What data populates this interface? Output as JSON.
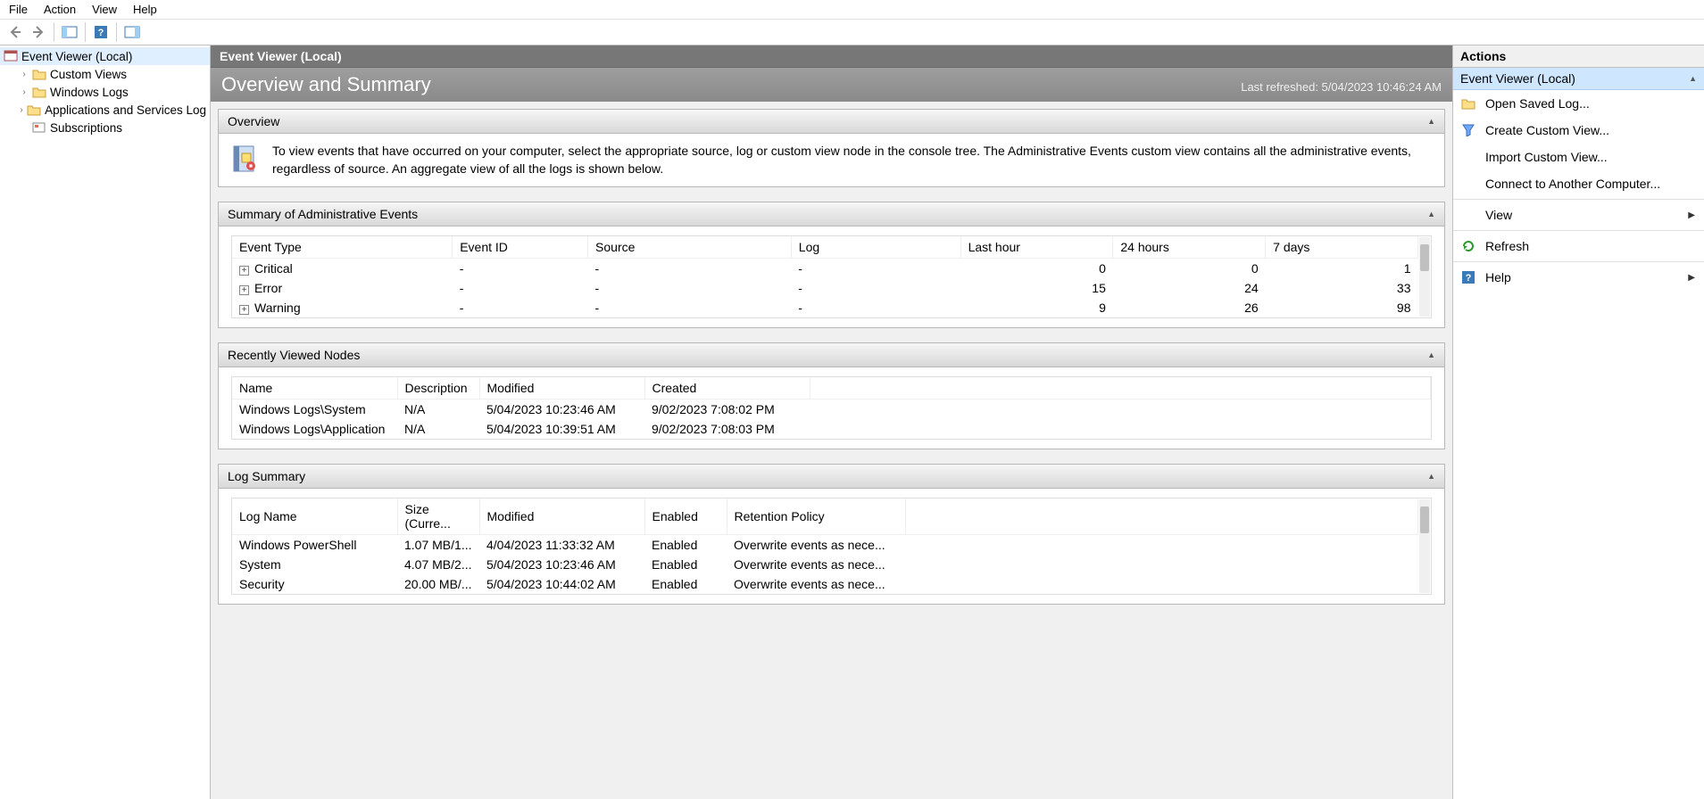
{
  "menubar": [
    "File",
    "Action",
    "View",
    "Help"
  ],
  "tree": {
    "root": "Event Viewer (Local)",
    "children": [
      "Custom Views",
      "Windows Logs",
      "Applications and Services Log",
      "Subscriptions"
    ]
  },
  "center": {
    "header": "Event Viewer (Local)",
    "overview_title": "Overview and Summary",
    "last_refreshed": "Last refreshed: 5/04/2023 10:46:24 AM",
    "overview_section": "Overview",
    "overview_text": "To view events that have occurred on your computer, select the appropriate source, log or custom view node in the console tree. The Administrative Events custom view contains all the administrative events, regardless of source. An aggregate view of all the logs is shown below.",
    "summary_section": "Summary of Administrative Events",
    "summary_headers": [
      "Event Type",
      "Event ID",
      "Source",
      "Log",
      "Last hour",
      "24 hours",
      "7 days"
    ],
    "summary_rows": [
      {
        "type": "Critical",
        "id": "-",
        "source": "-",
        "log": "-",
        "lh": "0",
        "d24": "0",
        "d7": "1"
      },
      {
        "type": "Error",
        "id": "-",
        "source": "-",
        "log": "-",
        "lh": "15",
        "d24": "24",
        "d7": "33"
      },
      {
        "type": "Warning",
        "id": "-",
        "source": "-",
        "log": "-",
        "lh": "9",
        "d24": "26",
        "d7": "98"
      }
    ],
    "recent_section": "Recently Viewed Nodes",
    "recent_headers": [
      "Name",
      "Description",
      "Modified",
      "Created"
    ],
    "recent_rows": [
      {
        "name": "Windows Logs\\System",
        "desc": "N/A",
        "mod": "5/04/2023 10:23:46 AM",
        "created": "9/02/2023 7:08:02 PM"
      },
      {
        "name": "Windows Logs\\Application",
        "desc": "N/A",
        "mod": "5/04/2023 10:39:51 AM",
        "created": "9/02/2023 7:08:03 PM"
      }
    ],
    "logsum_section": "Log Summary",
    "logsum_headers": [
      "Log Name",
      "Size (Curre...",
      "Modified",
      "Enabled",
      "Retention Policy"
    ],
    "logsum_rows": [
      {
        "name": "Windows PowerShell",
        "size": "1.07 MB/1...",
        "mod": "4/04/2023 11:33:32 AM",
        "enabled": "Enabled",
        "ret": "Overwrite events as nece..."
      },
      {
        "name": "System",
        "size": "4.07 MB/2...",
        "mod": "5/04/2023 10:23:46 AM",
        "enabled": "Enabled",
        "ret": "Overwrite events as nece..."
      },
      {
        "name": "Security",
        "size": "20.00 MB/...",
        "mod": "5/04/2023 10:44:02 AM",
        "enabled": "Enabled",
        "ret": "Overwrite events as nece..."
      }
    ]
  },
  "actions": {
    "title": "Actions",
    "group": "Event Viewer (Local)",
    "items": [
      {
        "label": "Open Saved Log...",
        "icon": "folder"
      },
      {
        "label": "Create Custom View...",
        "icon": "funnel"
      },
      {
        "label": "Import Custom View...",
        "icon": ""
      },
      {
        "label": "Connect to Another Computer...",
        "icon": ""
      },
      {
        "label": "View",
        "icon": "",
        "submenu": true,
        "divider_before": true
      },
      {
        "label": "Refresh",
        "icon": "refresh",
        "divider_before": true
      },
      {
        "label": "Help",
        "icon": "help",
        "submenu": true,
        "divider_before": true
      }
    ]
  }
}
